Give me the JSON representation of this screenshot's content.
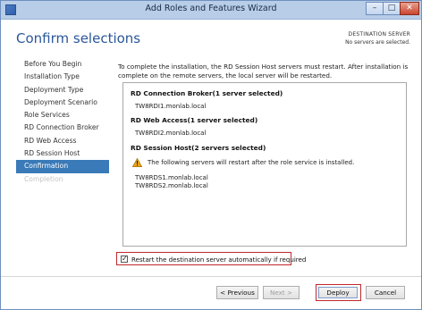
{
  "window": {
    "title": "Add Roles and Features Wizard"
  },
  "header": {
    "heading": "Confirm selections",
    "destination_label": "DESTINATION SERVER",
    "destination_value": "No servers are selected."
  },
  "nav": {
    "items": [
      {
        "label": "Before You Begin",
        "state": "normal"
      },
      {
        "label": "Installation Type",
        "state": "normal"
      },
      {
        "label": "Deployment Type",
        "state": "normal"
      },
      {
        "label": "Deployment Scenario",
        "state": "normal"
      },
      {
        "label": "Role Services",
        "state": "normal"
      },
      {
        "label": "RD Connection Broker",
        "state": "normal"
      },
      {
        "label": "RD Web Access",
        "state": "normal"
      },
      {
        "label": "RD Session Host",
        "state": "normal"
      },
      {
        "label": "Confirmation",
        "state": "active"
      },
      {
        "label": "Completion",
        "state": "disabled"
      }
    ]
  },
  "main": {
    "intro": "To complete the installation, the RD Session Host servers must restart. After installation is complete on the remote servers, the local server will be restarted.",
    "sections": {
      "broker": {
        "heading": "RD Connection Broker(1 server selected)",
        "servers": [
          "TW8RDI1.monlab.local"
        ]
      },
      "web": {
        "heading": "RD Web Access(1 server selected)",
        "servers": [
          "TW8RDI2.monlab.local"
        ]
      },
      "session": {
        "heading": "RD Session Host(2 servers selected)",
        "warning": "The following servers will restart after the role service is installed.",
        "servers": [
          "TW8RDS1.monlab.local",
          "TW8RDS2.monlab.local"
        ]
      }
    },
    "restart_checkbox": {
      "label": "Restart the destination server automatically if required",
      "checked": true
    }
  },
  "footer": {
    "previous_label": "< Previous",
    "next_label": "Next >",
    "deploy_label": "Deploy",
    "cancel_label": "Cancel"
  },
  "colors": {
    "accent": "#3a7ab8",
    "heading": "#2b579a",
    "highlight": "#c0282d",
    "warning": "#e8a317"
  },
  "icons": {
    "app": "server-manager-icon",
    "warning": "warning-triangle-icon",
    "check": "checkmark-icon"
  }
}
